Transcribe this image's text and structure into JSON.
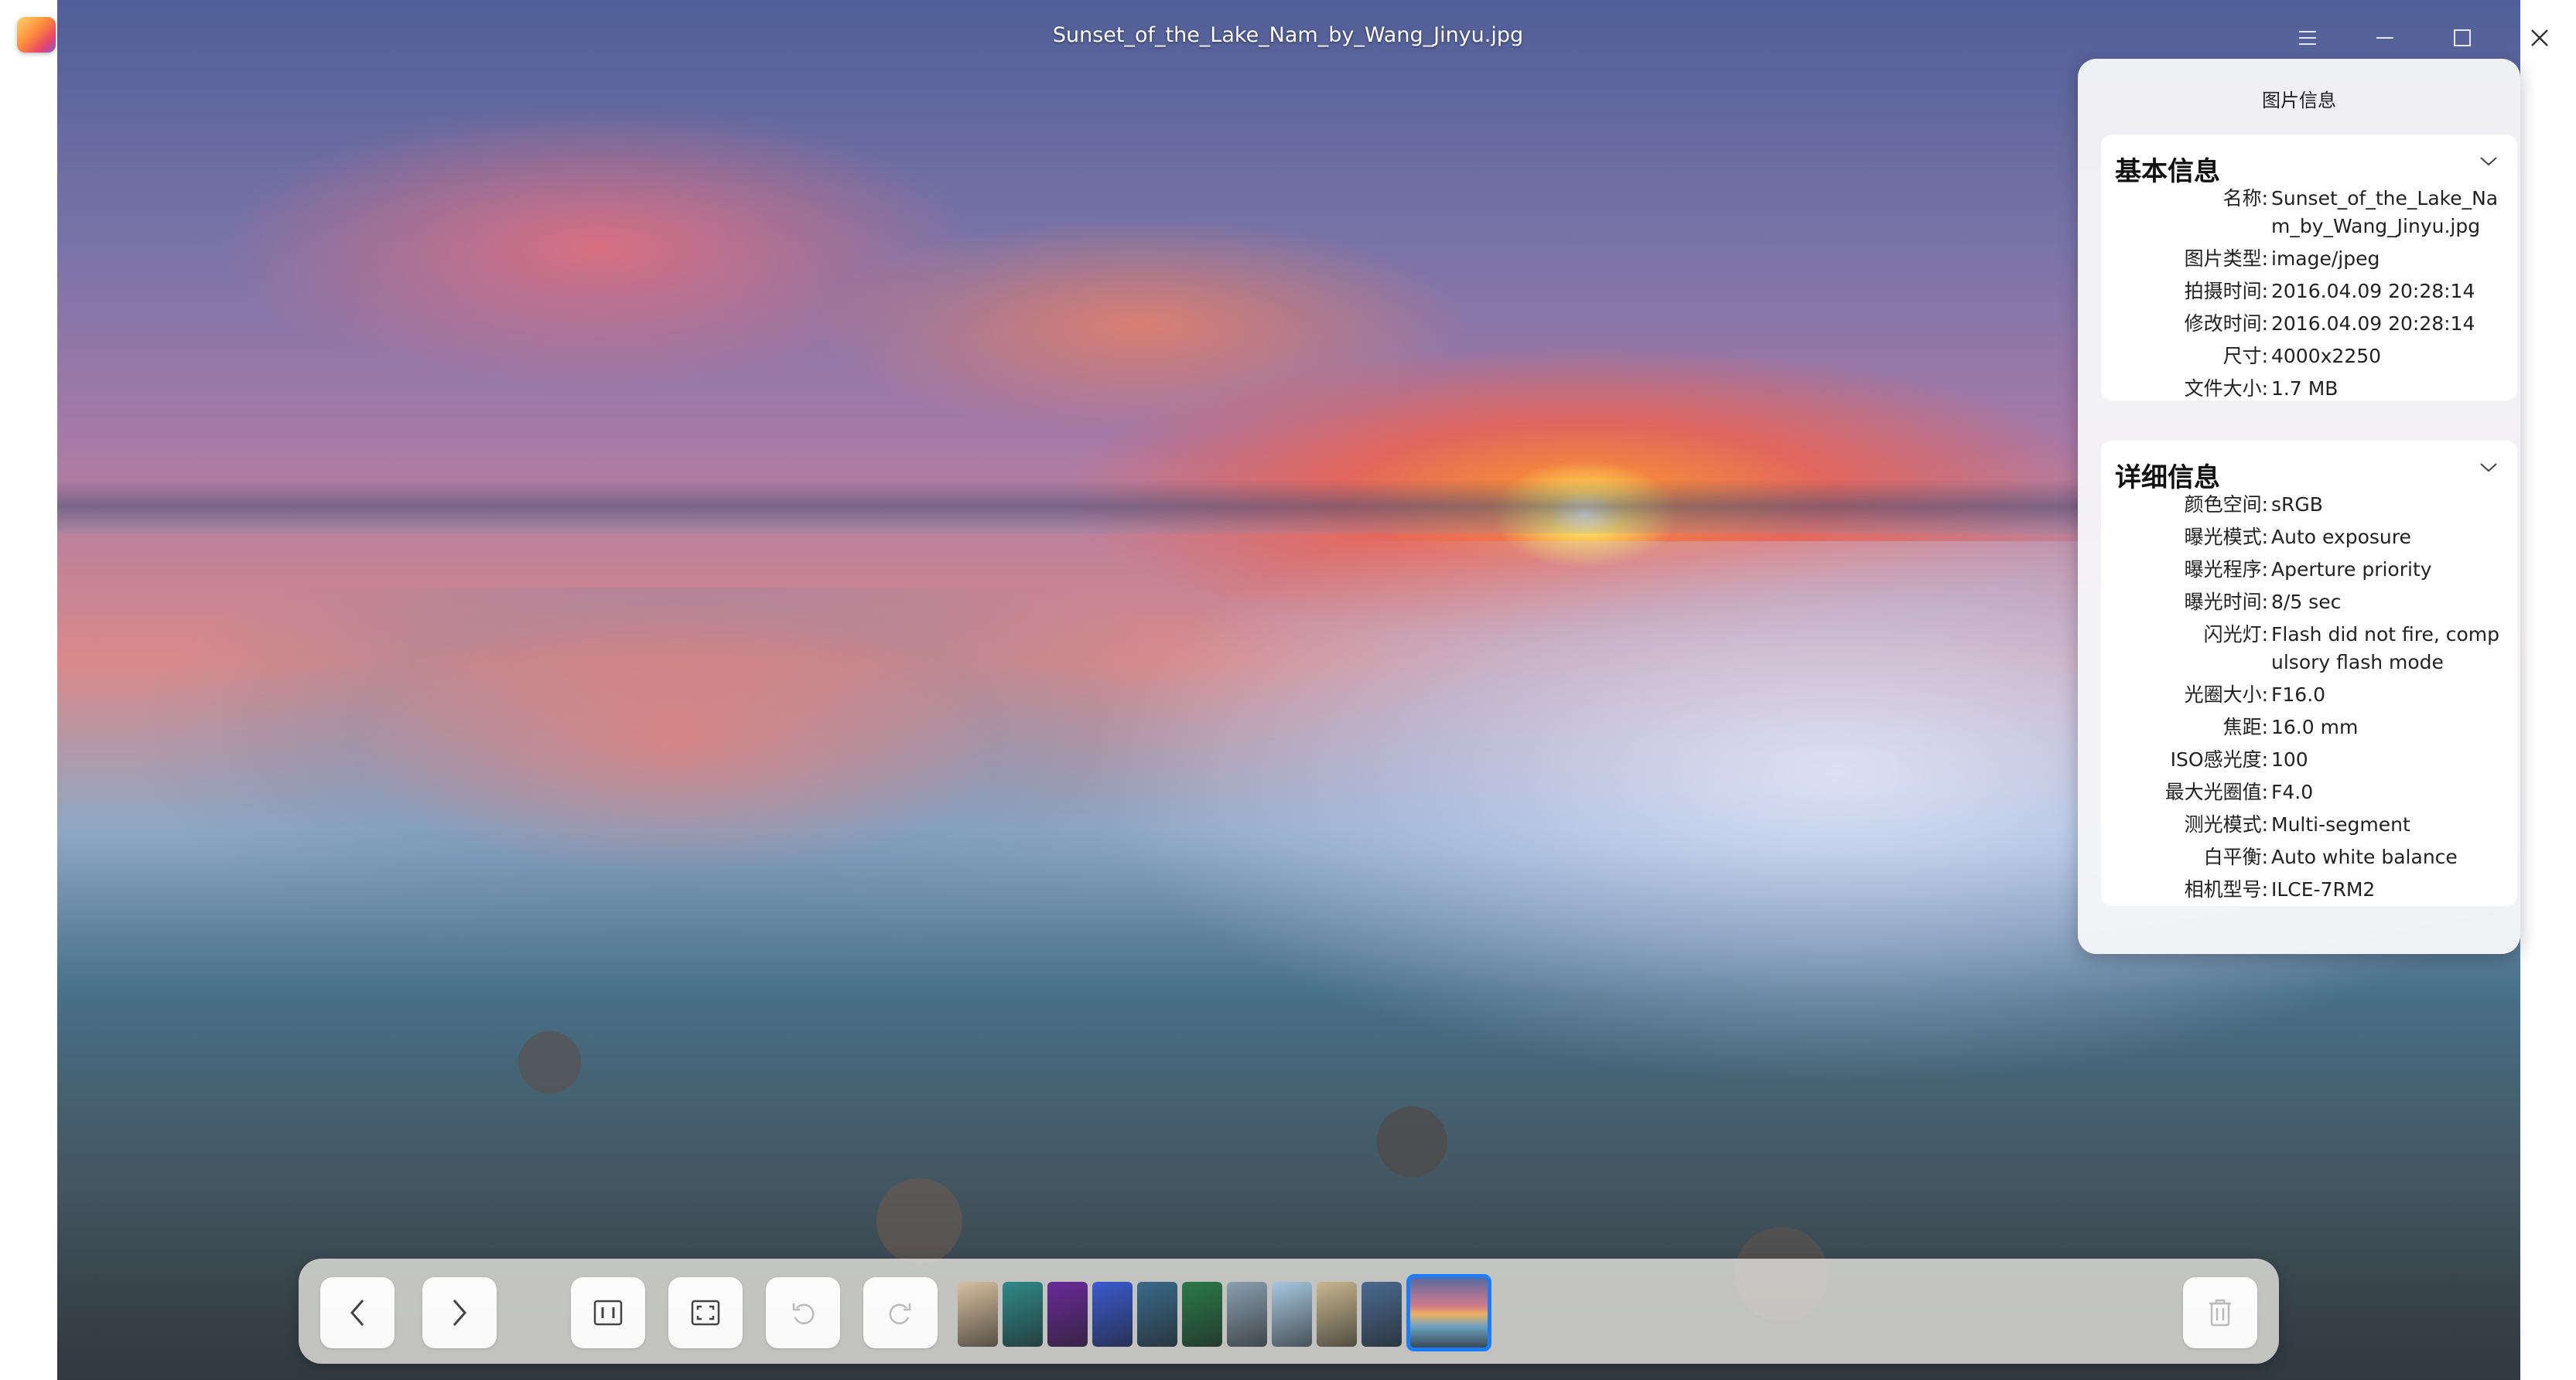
{
  "window": {
    "title": "Sunset_of_the_Lake_Nam_by_Wang_Jinyu.jpg",
    "controls": {
      "menu_icon": "menu-icon",
      "minimize_icon": "minimize-icon",
      "maximize_icon": "maximize-icon",
      "close_icon": "close-icon"
    }
  },
  "info_panel": {
    "title": "图片信息",
    "basic": {
      "heading": "基本信息",
      "rows": [
        {
          "label": "名称:",
          "value": "Sunset_of_the_Lake_Nam_by_Wang_Jinyu.jpg"
        },
        {
          "label": "图片类型:",
          "value": "image/jpeg"
        },
        {
          "label": "拍摄时间:",
          "value": "2016.04.09  20:28:14"
        },
        {
          "label": "修改时间:",
          "value": "2016.04.09  20:28:14"
        },
        {
          "label": "尺寸:",
          "value": "4000x2250"
        },
        {
          "label": "文件大小:",
          "value": "1.7  MB"
        }
      ]
    },
    "detail": {
      "heading": "详细信息",
      "rows": [
        {
          "label": "颜色空间:",
          "value": "sRGB"
        },
        {
          "label": "曝光模式:",
          "value": "Auto  exposure"
        },
        {
          "label": "曝光程序:",
          "value": "Aperture  priority"
        },
        {
          "label": "曝光时间:",
          "value": "8/5  sec"
        },
        {
          "label": "闪光灯:",
          "value": "Flash  did  not  fire,  compulsory  flash  mode"
        },
        {
          "label": "光圈大小:",
          "value": "F16.0"
        },
        {
          "label": "焦距:",
          "value": "16.0  mm"
        },
        {
          "label": "ISO感光度:",
          "value": "100"
        },
        {
          "label": "最大光圈值:",
          "value": "F4.0"
        },
        {
          "label": "测光模式:",
          "value": "Multi-segment"
        },
        {
          "label": "白平衡:",
          "value": "Auto  white  balance"
        },
        {
          "label": "相机型号:",
          "value": "ILCE-7RM2"
        }
      ]
    }
  },
  "toolbar": {
    "buttons": [
      "previous-icon",
      "next-icon",
      "original-size-icon",
      "fit-window-icon",
      "rotate-left-icon",
      "rotate-right-icon",
      "delete-icon"
    ],
    "thumbnail_colors": [
      "#d8c0a0",
      "#2f8a8a",
      "#6a2a9a",
      "#3a5ad0",
      "#3a6a8a",
      "#2a7a4a",
      "#8aa0b0",
      "#a8c8e0",
      "#c8b890",
      "#4a6a90",
      "#6a8aa8"
    ],
    "active_thumbnail": 10,
    "accent": "#1a7cff"
  }
}
